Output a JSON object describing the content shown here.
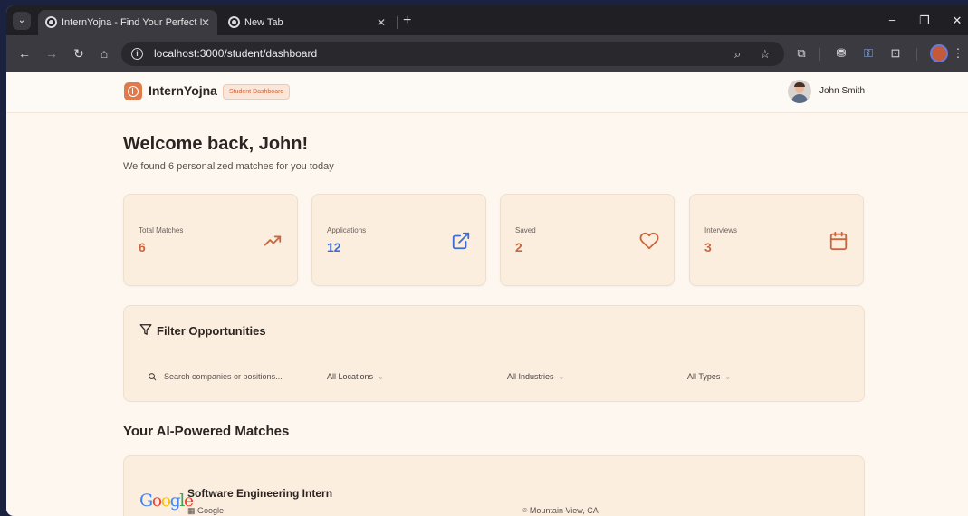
{
  "browser": {
    "tabs": [
      {
        "title": "InternYojna - Find Your Perfect I",
        "close": "✕"
      },
      {
        "title": "New Tab",
        "close": "✕"
      }
    ],
    "new_tab": "+",
    "tab_dropdown": "⌄",
    "window_controls": {
      "minimize": "−",
      "restore": "❐",
      "close": "✕"
    },
    "nav": {
      "back": "←",
      "forward": "→",
      "reload": "↻",
      "home": "⌂"
    },
    "url": "localhost:3000/student/dashboard",
    "info_glyph": "i",
    "omni_icons": {
      "zoom": "⌕",
      "bookmark": "☆"
    },
    "toolbar_icons": {
      "extensions": "⧉",
      "incognito": "⛃",
      "passwords": "⚿",
      "lens": "⊡",
      "menu": "⋮"
    }
  },
  "header": {
    "brand": "InternYojna",
    "badge": "Student Dashboard",
    "user_name": "John Smith"
  },
  "welcome": {
    "title": "Welcome back, John!",
    "subtitle": "We found 6 personalized matches for you today"
  },
  "stats": [
    {
      "label": "Total Matches",
      "value": "6",
      "icon": "trending-up-icon",
      "color": "#c9673f"
    },
    {
      "label": "Applications",
      "value": "12",
      "icon": "external-link-icon",
      "color": "#3d6ed8"
    },
    {
      "label": "Saved",
      "value": "2",
      "icon": "heart-icon",
      "color": "#c9673f"
    },
    {
      "label": "Interviews",
      "value": "3",
      "icon": "calendar-icon",
      "color": "#c9673f"
    }
  ],
  "filters": {
    "title": "Filter Opportunities",
    "search_placeholder": "Search companies or positions...",
    "location": "All Locations",
    "industry": "All Industries",
    "type": "All Types",
    "chevron": "⌄"
  },
  "matches": {
    "title": "Your AI-Powered Matches",
    "jobs": [
      {
        "title": "Software Engineering Intern",
        "company": "Google",
        "company_icon": "▦",
        "location": "Mountain View, CA",
        "location_icon": "⌾",
        "logo": "Google"
      }
    ]
  },
  "colors": {
    "accent": "#e07a4c",
    "card_bg": "#fbeedf",
    "page_bg": "#fdf7f0",
    "link_blue": "#3d6ed8"
  }
}
